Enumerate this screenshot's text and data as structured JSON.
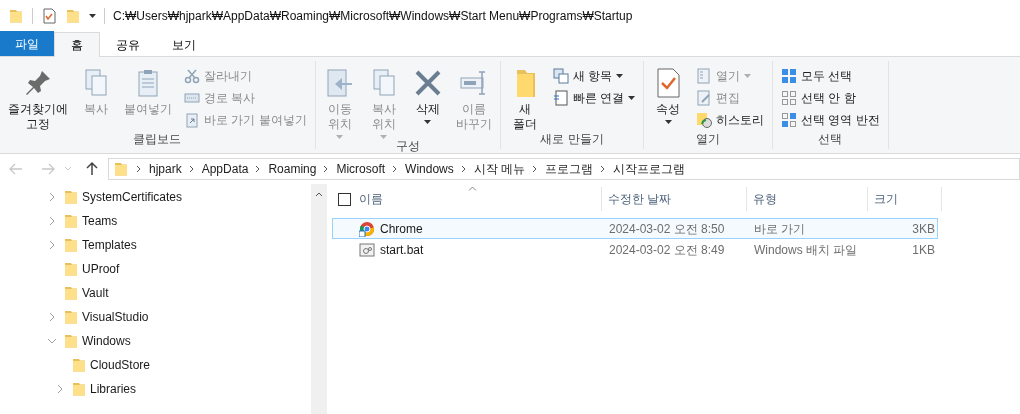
{
  "window": {
    "title": "C:₩Users₩hjpark₩AppData₩Roaming₩Microsoft₩Windows₩Start Menu₩Programs₩Startup"
  },
  "tabs": [
    {
      "label": "파일",
      "kind": "file",
      "selected": false
    },
    {
      "label": "홈",
      "kind": "tab",
      "selected": true
    },
    {
      "label": "공유",
      "kind": "tab",
      "selected": false
    },
    {
      "label": "보기",
      "kind": "tab",
      "selected": false
    }
  ],
  "ribbon": [
    {
      "label": "클립보드",
      "columns": [
        {
          "kind": "large",
          "items": [
            {
              "label": "즐겨찾기에\n고정",
              "disabled": false,
              "dropdown": false
            }
          ]
        },
        {
          "kind": "large",
          "items": [
            {
              "label": "복사",
              "disabled": true,
              "dropdown": false
            }
          ]
        },
        {
          "kind": "large",
          "items": [
            {
              "label": "붙여넣기",
              "disabled": true,
              "dropdown": false
            }
          ]
        },
        {
          "kind": "small",
          "items": [
            {
              "label": "잘라내기",
              "disabled": true,
              "dropdown": false
            },
            {
              "label": "경로 복사",
              "disabled": true,
              "dropdown": false
            },
            {
              "label": "바로 가기 붙여넣기",
              "disabled": true,
              "dropdown": false
            }
          ]
        }
      ]
    },
    {
      "label": "구성",
      "columns": [
        {
          "kind": "large",
          "items": [
            {
              "label": "이동\n위치",
              "disabled": true,
              "dropdown": true
            }
          ]
        },
        {
          "kind": "large",
          "items": [
            {
              "label": "복사\n위치",
              "disabled": true,
              "dropdown": true
            }
          ]
        },
        {
          "kind": "large",
          "items": [
            {
              "label": "삭제",
              "disabled": false,
              "dropdown": true
            }
          ]
        },
        {
          "kind": "large",
          "items": [
            {
              "label": "이름\n바꾸기",
              "disabled": true,
              "dropdown": false
            }
          ]
        }
      ]
    },
    {
      "label": "새로 만들기",
      "columns": [
        {
          "kind": "large",
          "items": [
            {
              "label": "새\n폴더",
              "disabled": false,
              "dropdown": false
            }
          ]
        },
        {
          "kind": "small",
          "items": [
            {
              "label": "새 항목",
              "disabled": false,
              "dropdown": true
            },
            {
              "label": "빠른 연결",
              "disabled": false,
              "dropdown": true
            }
          ]
        }
      ]
    },
    {
      "label": "열기",
      "columns": [
        {
          "kind": "large",
          "items": [
            {
              "label": "속성",
              "disabled": false,
              "dropdown": true
            }
          ]
        },
        {
          "kind": "small",
          "items": [
            {
              "label": "열기",
              "disabled": true,
              "dropdown": true
            },
            {
              "label": "편집",
              "disabled": true,
              "dropdown": false
            },
            {
              "label": "히스토리",
              "disabled": false,
              "dropdown": false
            }
          ]
        }
      ]
    },
    {
      "label": "선택",
      "columns": [
        {
          "kind": "small",
          "items": [
            {
              "label": "모두 선택",
              "disabled": false,
              "dropdown": false
            },
            {
              "label": "선택 안 함",
              "disabled": false,
              "dropdown": false
            },
            {
              "label": "선택 영역 반전",
              "disabled": false,
              "dropdown": false
            }
          ]
        }
      ]
    }
  ],
  "breadcrumb": [
    "hjpark",
    "AppData",
    "Roaming",
    "Microsoft",
    "Windows",
    "시작 메뉴",
    "프로그램",
    "시작프로그램"
  ],
  "tree": [
    {
      "label": "SystemCertificates",
      "expanded": false
    },
    {
      "label": "Teams",
      "expanded": false
    },
    {
      "label": "Templates",
      "expanded": false
    },
    {
      "label": "UProof"
    },
    {
      "label": "Vault"
    },
    {
      "label": "VisualStudio",
      "expanded": false
    },
    {
      "label": "Windows",
      "expanded": true,
      "children": [
        {
          "label": "CloudStore"
        },
        {
          "label": "Libraries",
          "expanded": false
        }
      ]
    }
  ],
  "table": {
    "select_all": {
      "checked": false
    },
    "columns": [
      "이름",
      "수정한 날짜",
      "유형",
      "크기"
    ],
    "rows": [
      {
        "kind": "chrome",
        "name": "Chrome",
        "date": "2024-03-02 오전 8:50",
        "type": "바로 가기",
        "size": "3KB",
        "selected": true
      },
      {
        "kind": "batch",
        "name": "start.bat",
        "date": "2024-03-02 오전 8:49",
        "type": "Windows 배치 파일",
        "size": "1KB",
        "selected": false
      }
    ]
  }
}
